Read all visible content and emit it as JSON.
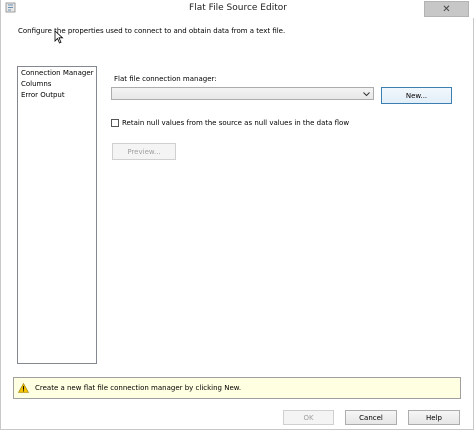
{
  "window": {
    "title": "Flat File Source Editor",
    "close_symbol": "✕"
  },
  "instruction": "Configure the properties used to connect to and obtain data from a text file.",
  "nav": {
    "items": [
      {
        "label": "Connection Manager"
      },
      {
        "label": "Columns"
      },
      {
        "label": "Error Output"
      }
    ]
  },
  "connection": {
    "label": "Flat file connection manager:",
    "selected_value": "",
    "new_button": "New..."
  },
  "retain_nulls": {
    "label": "Retain null values from the source as null values in the data flow",
    "checked": false
  },
  "preview_button": "Preview...",
  "info_bar": {
    "message": "Create a new flat file connection manager by clicking New."
  },
  "footer": {
    "ok": "OK",
    "cancel": "Cancel",
    "help": "Help"
  },
  "colors": {
    "info_background": "#ffffe1",
    "warning_icon": "#f3c300"
  }
}
